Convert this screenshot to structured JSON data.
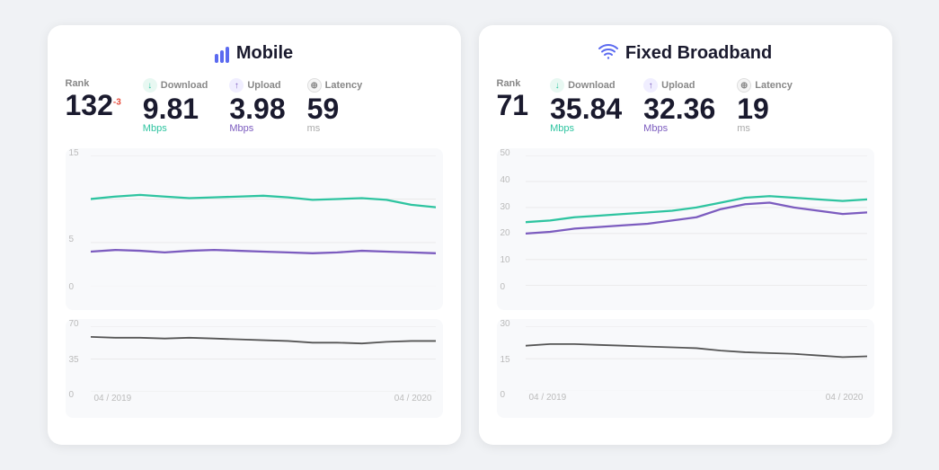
{
  "mobile": {
    "title": "Mobile",
    "rank_label": "Rank",
    "rank_value": "132",
    "rank_change": "-3",
    "download_label": "Download",
    "download_value": "9.81",
    "download_unit": "Mbps",
    "upload_label": "Upload",
    "upload_value": "3.98",
    "upload_unit": "Mbps",
    "latency_label": "Latency",
    "latency_value": "59",
    "latency_unit": "ms",
    "chart_y_max": "15",
    "chart_y_mid": "",
    "chart_y_5": "5",
    "chart_y_0": "0",
    "latency_y_top": "70",
    "latency_y_mid": "35",
    "latency_y_bot": "0",
    "x_start": "04 / 2019",
    "x_end": "04 / 2020"
  },
  "broadband": {
    "title": "Fixed Broadband",
    "rank_label": "Rank",
    "rank_value": "71",
    "download_label": "Download",
    "download_value": "35.84",
    "download_unit": "Mbps",
    "upload_label": "Upload",
    "upload_value": "32.36",
    "upload_unit": "Mbps",
    "latency_label": "Latency",
    "latency_value": "19",
    "latency_unit": "ms",
    "chart_y_50": "50",
    "chart_y_40": "40",
    "chart_y_30": "30",
    "chart_y_20": "20",
    "chart_y_10": "10",
    "chart_y_0": "0",
    "latency_y_top": "30",
    "latency_y_mid": "15",
    "latency_y_bot": "0",
    "x_start": "04 / 2019",
    "x_end": "04 / 2020"
  }
}
